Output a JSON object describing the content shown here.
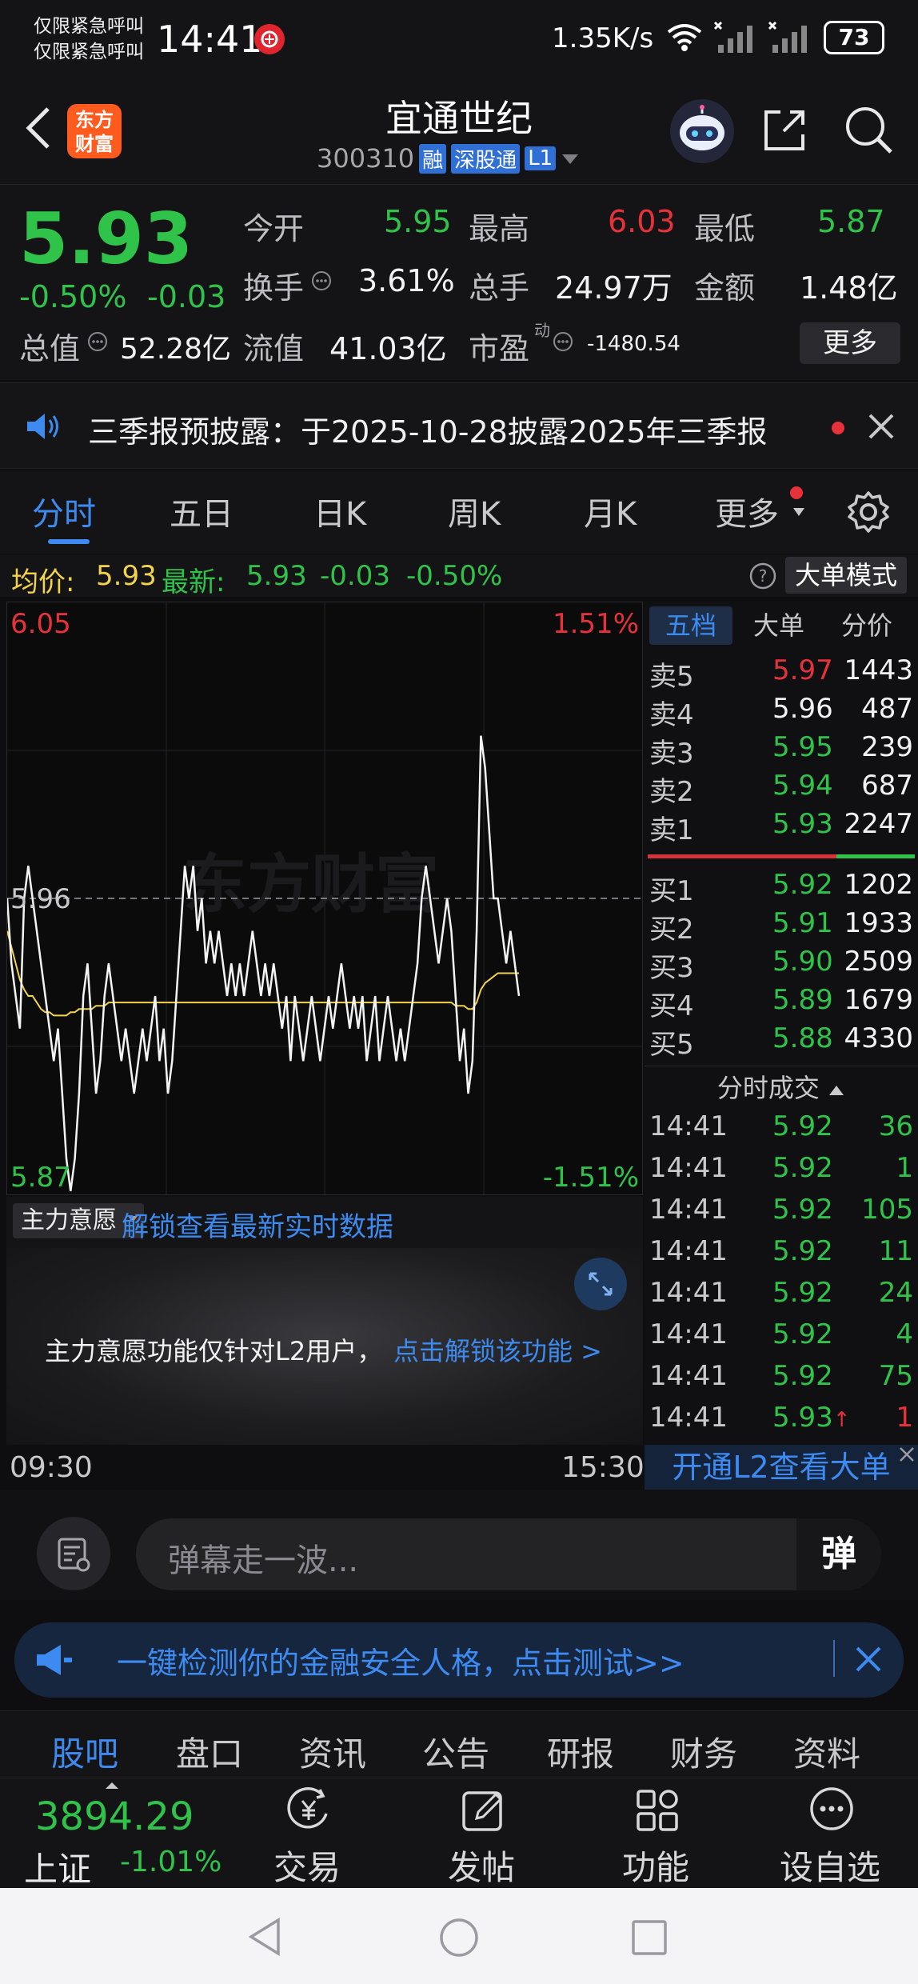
{
  "status_bar": {
    "emergency_line1": "仅限紧急呼叫",
    "emergency_line2": "仅限紧急呼叫",
    "time": "14:41",
    "network_speed": "1.35K/s",
    "battery": "73"
  },
  "header": {
    "logo_text": "东方财富",
    "stock_name": "宜通世纪",
    "stock_code": "300310",
    "tag_margin": "融",
    "tag_connect": "深股通",
    "tag_level": "L1"
  },
  "quote": {
    "price": "5.93",
    "change_pct": "-0.50%",
    "change_amt": "-0.03",
    "open_label": "今开",
    "open_value": "5.95",
    "high_label": "最高",
    "high_value": "6.03",
    "low_label": "最低",
    "low_value": "5.87",
    "turnover_label": "换手",
    "turnover_value": "3.61%",
    "volume_label": "总手",
    "volume_value": "24.97万",
    "amount_label": "金额",
    "amount_value": "1.48亿",
    "mktcap_label": "总值",
    "mktcap_value": "52.28亿",
    "float_label": "流值",
    "float_value": "41.03亿",
    "pe_label": "市盈",
    "pe_sup": "动",
    "pe_value": "-1480.54",
    "more_button": "更多"
  },
  "notice": {
    "text": "三季报预披露：于2025-10-28披露2025年三季报"
  },
  "tabs": {
    "items": [
      "分时",
      "五日",
      "日K",
      "周K",
      "月K",
      "更多"
    ],
    "active": 0
  },
  "info_row": {
    "avg_label": "均价:",
    "avg_value": "5.93",
    "latest_label": "最新:",
    "latest_value": "5.93",
    "latest_change": "-0.03",
    "latest_pct": "-0.50%",
    "big_order_mode": "大单模式"
  },
  "chart_data": {
    "type": "line",
    "y_top_label": "6.05",
    "y_mid_label": "5.96",
    "y_bottom_label": "5.87",
    "pct_top_label": "1.51%",
    "pct_bottom_label": "-1.51%",
    "ylim": [
      5.87,
      6.05
    ],
    "x_start_label": "09:30",
    "x_end_label": "15:30",
    "watermark": "东方财富",
    "series": [
      {
        "values": [
          5.96,
          5.94,
          5.93,
          5.92,
          5.96,
          5.97,
          5.96,
          5.95,
          5.94,
          5.93,
          5.92,
          5.91,
          5.92,
          5.9,
          5.88,
          5.87,
          5.88,
          5.9,
          5.93,
          5.94,
          5.92,
          5.9,
          5.91,
          5.93,
          5.94,
          5.93,
          5.92,
          5.91,
          5.92,
          5.91,
          5.9,
          5.91,
          5.92,
          5.91,
          5.92,
          5.93,
          5.91,
          5.92,
          5.9,
          5.91,
          5.93,
          5.95,
          5.97,
          5.96,
          5.97,
          5.95,
          5.96,
          5.94,
          5.95,
          5.94,
          5.95,
          5.94,
          5.93,
          5.94,
          5.93,
          5.94,
          5.93,
          5.94,
          5.95,
          5.94,
          5.93,
          5.94,
          5.93,
          5.94,
          5.93,
          5.92,
          5.93,
          5.91,
          5.93,
          5.92,
          5.91,
          5.92,
          5.93,
          5.92,
          5.91,
          5.92,
          5.93,
          5.92,
          5.93,
          5.94,
          5.93,
          5.92,
          5.93,
          5.92,
          5.93,
          5.91,
          5.92,
          5.93,
          5.91,
          5.92,
          5.93,
          5.92,
          5.91,
          5.92,
          5.91,
          5.92,
          5.93,
          5.94,
          5.96,
          5.97,
          5.96,
          5.95,
          5.94,
          5.95,
          5.96,
          5.95,
          5.93,
          5.91,
          5.92,
          5.9,
          5.91,
          5.95,
          6.01,
          6.0,
          5.98,
          5.96,
          5.96,
          5.95,
          5.94,
          5.95,
          5.94,
          5.93
        ]
      },
      {
        "values": [
          5.95,
          5.945,
          5.94,
          5.935,
          5.932,
          5.93,
          5.93,
          5.928,
          5.926,
          5.925,
          5.925,
          5.924,
          5.924,
          5.924,
          5.924,
          5.925,
          5.925,
          5.926,
          5.926,
          5.926,
          5.926,
          5.927,
          5.927,
          5.927,
          5.928,
          5.928,
          5.928,
          5.928,
          5.928,
          5.928,
          5.928,
          5.928,
          5.928,
          5.928,
          5.928,
          5.928,
          5.928,
          5.928,
          5.928,
          5.928,
          5.928,
          5.928,
          5.928,
          5.928,
          5.928,
          5.928,
          5.928,
          5.928,
          5.928,
          5.928,
          5.928,
          5.928,
          5.928,
          5.928,
          5.928,
          5.928,
          5.928,
          5.928,
          5.928,
          5.928,
          5.928,
          5.928,
          5.928,
          5.928,
          5.928,
          5.928,
          5.928,
          5.928,
          5.928,
          5.928,
          5.928,
          5.928,
          5.928,
          5.928,
          5.928,
          5.928,
          5.928,
          5.928,
          5.928,
          5.928,
          5.928,
          5.928,
          5.928,
          5.928,
          5.928,
          5.928,
          5.928,
          5.928,
          5.928,
          5.928,
          5.928,
          5.928,
          5.928,
          5.928,
          5.928,
          5.928,
          5.928,
          5.928,
          5.928,
          5.928,
          5.928,
          5.928,
          5.928,
          5.928,
          5.928,
          5.928,
          5.927,
          5.927,
          5.927,
          5.926,
          5.926,
          5.928,
          5.932,
          5.934,
          5.935,
          5.936,
          5.937,
          5.937,
          5.937,
          5.937,
          5.937,
          5.937
        ]
      }
    ]
  },
  "book": {
    "tabs": [
      "五档",
      "大单",
      "分价"
    ],
    "asks": [
      {
        "label": "卖5",
        "price": "5.97",
        "vol": "1443",
        "color": "red"
      },
      {
        "label": "卖4",
        "price": "5.96",
        "vol": "487",
        "color": "white"
      },
      {
        "label": "卖3",
        "price": "5.95",
        "vol": "239",
        "color": "green"
      },
      {
        "label": "卖2",
        "price": "5.94",
        "vol": "687",
        "color": "green"
      },
      {
        "label": "卖1",
        "price": "5.93",
        "vol": "2247",
        "color": "green"
      }
    ],
    "bids": [
      {
        "label": "买1",
        "price": "5.92",
        "vol": "1202",
        "color": "green"
      },
      {
        "label": "买2",
        "price": "5.91",
        "vol": "1933",
        "color": "green"
      },
      {
        "label": "买3",
        "price": "5.90",
        "vol": "2509",
        "color": "green"
      },
      {
        "label": "买4",
        "price": "5.89",
        "vol": "1679",
        "color": "green"
      },
      {
        "label": "买5",
        "price": "5.88",
        "vol": "4330",
        "color": "green"
      }
    ],
    "trades_title": "分时成交",
    "trades": [
      {
        "time": "14:41",
        "price": "5.92",
        "vol": "36",
        "vcolor": "green"
      },
      {
        "time": "14:41",
        "price": "5.92",
        "vol": "1",
        "vcolor": "green"
      },
      {
        "time": "14:41",
        "price": "5.92",
        "vol": "105",
        "vcolor": "green"
      },
      {
        "time": "14:41",
        "price": "5.92",
        "vol": "11",
        "vcolor": "green"
      },
      {
        "time": "14:41",
        "price": "5.92",
        "vol": "24",
        "vcolor": "green"
      },
      {
        "time": "14:41",
        "price": "5.92",
        "vol": "4",
        "vcolor": "green"
      },
      {
        "time": "14:41",
        "price": "5.92",
        "vol": "75",
        "vcolor": "green"
      },
      {
        "time": "14:41",
        "price": "5.93",
        "vol": "1",
        "vcolor": "red"
      }
    ],
    "l2_button": "开通L2查看大单"
  },
  "indicator": {
    "selector": "主力意愿",
    "unlock_link": "解锁查看最新实时数据",
    "message": "主力意愿功能仅针对L2用户，",
    "message_link": "点击解锁该功能 >"
  },
  "danmu": {
    "placeholder": "弹幕走一波...",
    "send_label": "弹"
  },
  "banner": {
    "text": "一键检测你的金融安全人格，点击测试>>"
  },
  "subtabs": [
    "股吧",
    "盘口",
    "资讯",
    "公告",
    "研报",
    "财务",
    "资料"
  ],
  "bottom_nav": {
    "index_value": "3894.29",
    "index_name": "上证",
    "index_pct": "-1.01%",
    "items": [
      "交易",
      "发帖",
      "功能",
      "设自选"
    ]
  },
  "colors": {
    "up": "#e8323a",
    "down": "#2fc34a",
    "accent": "#3d8bf0",
    "avg_line": "#f2d34a"
  }
}
